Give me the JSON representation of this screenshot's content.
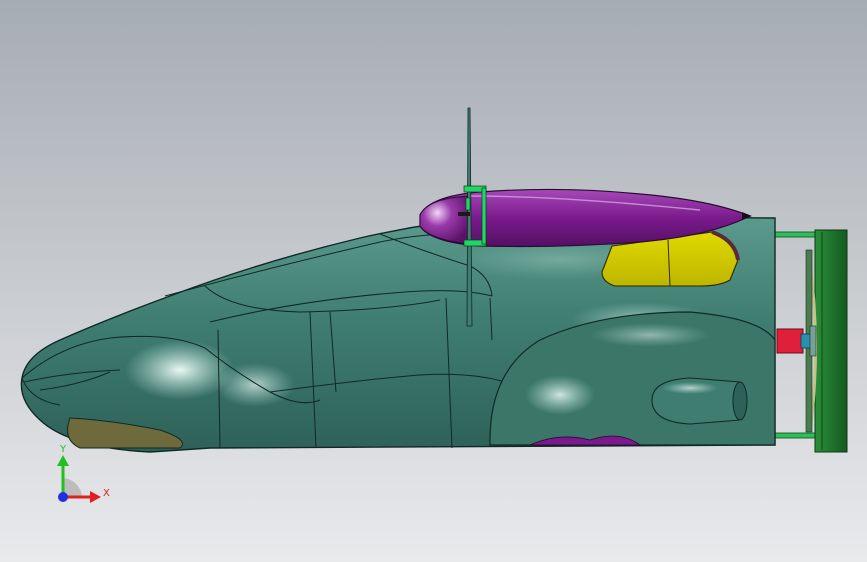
{
  "viewport": {
    "background_top": "#a6acb3",
    "background_bottom": "#e9eaec"
  },
  "model": {
    "body_color": "#3f7d71",
    "body_highlight": "#bfe6dc",
    "canopy_color": "#7b1a8c",
    "window_color": "#d4cc00",
    "frame_color": "#1f7a2e",
    "hub_color": "#e0203a",
    "strut_color": "#22d46a"
  },
  "triad": {
    "x_label": "X",
    "y_label": "Y",
    "x_color": "#e02020",
    "y_color": "#20c020",
    "z_color": "#2030e0"
  }
}
